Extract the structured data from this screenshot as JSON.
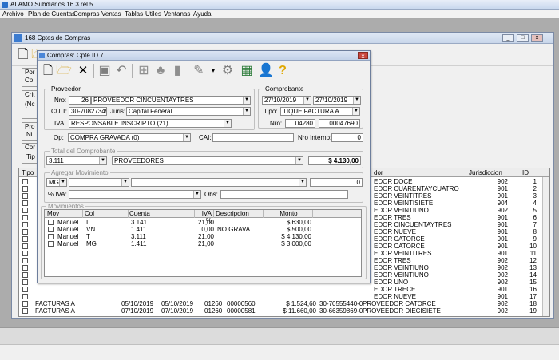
{
  "app": {
    "title": "ALAMO Subdiarios 16.3 rel 5",
    "menu": [
      "Archivo",
      "Plan de Cuentas",
      "Compras",
      "Ventas",
      "Tablas",
      "Utiles",
      "Ventanas",
      "Ayuda"
    ]
  },
  "main_window": {
    "title": "168 Cptes de Compras",
    "left_labels": [
      "Por",
      "Cp",
      "Crit",
      "(Nc",
      "Pro",
      "Ni",
      "Cor",
      "Tip"
    ],
    "grid": {
      "headers": {
        "tipo": "Tipo",
        "proveedor": "dor",
        "jurisdiccion": "Jurisdiccion",
        "id": "ID"
      },
      "rows": [
        {
          "proveedor": "EDOR DOCE",
          "jur": "902",
          "id": "1"
        },
        {
          "proveedor": "EDOR CUARENTAYCUATRO",
          "jur": "901",
          "id": "2"
        },
        {
          "proveedor": "EDOR VEINTITRES",
          "jur": "901",
          "id": "3"
        },
        {
          "proveedor": "EDOR VEINTISIETE",
          "jur": "904",
          "id": "4"
        },
        {
          "proveedor": "EDOR VEINTIUNO",
          "jur": "902",
          "id": "5"
        },
        {
          "proveedor": "EDOR TRES",
          "jur": "901",
          "id": "6"
        },
        {
          "proveedor": "EDOR CINCUENTAYTRES",
          "jur": "901",
          "id": "7"
        },
        {
          "proveedor": "EDOR NUEVE",
          "jur": "901",
          "id": "8"
        },
        {
          "proveedor": "EDOR CATORCE",
          "jur": "901",
          "id": "9"
        },
        {
          "proveedor": "EDOR CATORCE",
          "jur": "901",
          "id": "10"
        },
        {
          "proveedor": "EDOR VEINTITRES",
          "jur": "901",
          "id": "11"
        },
        {
          "proveedor": "EDOR TRES",
          "jur": "902",
          "id": "12"
        },
        {
          "proveedor": "EDOR VEINTIUNO",
          "jur": "902",
          "id": "13"
        },
        {
          "proveedor": "EDOR VEINTIUNO",
          "jur": "902",
          "id": "14"
        },
        {
          "proveedor": "EDOR UNO",
          "jur": "902",
          "id": "15"
        },
        {
          "proveedor": "EDOR TRECE",
          "jur": "901",
          "id": "16"
        },
        {
          "proveedor": "EDOR NUEVE",
          "jur": "901",
          "id": "17"
        }
      ],
      "full_rows": [
        {
          "tipo": "FACTURAS A",
          "f1": "05/10/2019",
          "f2": "05/10/2019",
          "pv": "01260",
          "nro": "00000560",
          "monto": "$ 1.524,60",
          "cuit": "30-70555440-0",
          "proveedor": "PROVEEDOR CATORCE",
          "jur": "902",
          "id": "18"
        },
        {
          "tipo": "FACTURAS A",
          "f1": "07/10/2019",
          "f2": "07/10/2019",
          "pv": "01260",
          "nro": "00000581",
          "monto": "$ 11.660,00",
          "cuit": "30-66359869-0",
          "proveedor": "PROVEEDOR DIECISIETE",
          "jur": "902",
          "id": "19"
        }
      ]
    }
  },
  "dialog": {
    "title": "Compras: Cpte ID 7",
    "close_label": "x",
    "proveedor": {
      "legend": "Proveedor",
      "nro_label": "Nro:",
      "nro_value": "26",
      "name": "PROVEEDOR CINCUENTAYTRES",
      "cuit_label": "CUIT:",
      "cuit_value": "30-70827345-3",
      "juris_label": "Juris:",
      "juris_value": "Capital Federal",
      "iva_label": "IVA:",
      "iva_value": "RESPONSABLE INSCRIPTO (21)"
    },
    "comprobante": {
      "legend": "Comprobante",
      "fecha1": "27/10/2019",
      "fecha2": "27/10/2019",
      "tipo_label": "Tipo:",
      "tipo_value": "TIQUE FACTURA A",
      "nro_label": "Nro:",
      "pv": "04280",
      "numero": "00047690"
    },
    "op_label": "Op:",
    "op_value": "COMPRA GRAVADA (0)",
    "cai_label": "CAI:",
    "cai_value": "",
    "nro_interno_label": "Nro Interno:",
    "nro_interno_value": "0",
    "total": {
      "legend": "Total del Comprobante",
      "cuenta": "3.111",
      "cuenta_name": "PROVEEDORES",
      "monto": "$ 4.130,00"
    },
    "agregar": {
      "legend": "Agregar Movimiento",
      "tipo": "MG",
      "monto": "0",
      "iva_label": "% IVA:",
      "obs_label": "Obs:"
    },
    "movimientos": {
      "legend": "Movimientos",
      "headers": [
        "Mov",
        "Col",
        "Cuenta",
        "IVA %",
        "Descripcion",
        "Monto"
      ],
      "rows": [
        {
          "mov": "Manuel",
          "col": "I",
          "cuenta": "3.141",
          "iva": "21,00",
          "desc": "",
          "monto": "$ 630,00"
        },
        {
          "mov": "Manuel",
          "col": "VN",
          "cuenta": "1.411",
          "iva": "0,00",
          "desc": "NO GRAVA...",
          "monto": "$ 500,00"
        },
        {
          "mov": "Manuel",
          "col": "T",
          "cuenta": "3.111",
          "iva": "21,00",
          "desc": "",
          "monto": "$ 4.130,00"
        },
        {
          "mov": "Manuel",
          "col": "MG",
          "cuenta": "1.411",
          "iva": "21,00",
          "desc": "",
          "monto": "$ 3.000,00"
        }
      ]
    }
  }
}
